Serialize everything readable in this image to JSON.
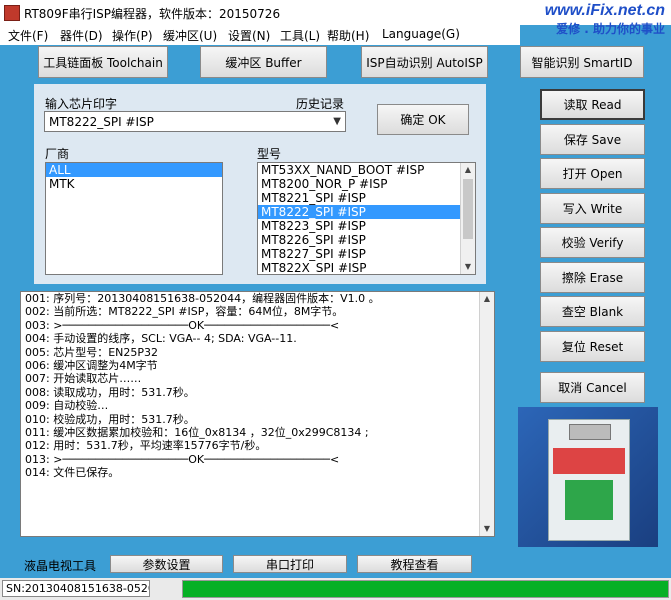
{
  "title": "RT809F串行ISP编程器，软件版本：20150726",
  "watermark": {
    "site": "www.iFix.net.cn",
    "slogan": "爱修 . 助力你的事业"
  },
  "menu": [
    "文件(F)",
    "器件(D)",
    "操作(P)",
    "缓冲区(U)",
    "设置(N)",
    "工具(L)",
    "帮助(H)",
    "Language(G)"
  ],
  "toolbar": {
    "toolchain": "工具链面板 Toolchain",
    "buffer": "缓冲区 Buffer",
    "autoisp": "ISP自动识别 AutoISP",
    "smartid": "智能识别 SmartID"
  },
  "chip_input": {
    "label": "输入芯片印字",
    "history_label": "历史记录",
    "value": "MT8222_SPI #ISP",
    "ok_button": "确定 OK"
  },
  "vendor": {
    "label": "厂商",
    "items": [
      "ALL",
      "MTK"
    ],
    "selected": "ALL"
  },
  "model": {
    "label": "型号",
    "items": [
      "MT53XX_NAND_BOOT #ISP",
      "MT8200_NOR_P #ISP",
      "MT8221_SPI #ISP",
      "MT8222_SPI #ISP",
      "MT8223_SPI #ISP",
      "MT8226_SPI #ISP",
      "MT8227_SPI #ISP",
      "MT822X_SPI #ISP"
    ],
    "selected": "MT8222_SPI #ISP"
  },
  "log_lines": [
    "001: 序列号：20130408151638-052044，编程器固件版本：V1.0 。",
    "002: 当前所选：MT8222_SPI #ISP，容量：64M位，8M字节。",
    "003: >───────────────────OK───────────────────<",
    "004: 手动设置的线序，SCL: VGA-- 4; SDA: VGA--11.",
    "005: 芯片型号：EN25P32",
    "006: 缓冲区调整为4M字节",
    "007: 开始读取芯片……",
    "008: 读取成功，用时：531.7秒。",
    "009: 自动校验…",
    "010: 校验成功，用时：531.7秒。",
    "011: 缓冲区数据累加校验和：16位_0x8134 ，32位_0x299C8134 ;",
    "012: 用时：531.7秒，平均速率15776字节/秒。",
    "013: >───────────────────OK───────────────────<",
    "014: 文件已保存。"
  ],
  "side_buttons": {
    "read": "读取 Read",
    "save": "保存 Save",
    "open": "打开 Open",
    "write": "写入 Write",
    "verify": "校验 Verify",
    "erase": "擦除 Erase",
    "blank": "查空 Blank",
    "reset": "复位 Reset",
    "cancel": "取消 Cancel"
  },
  "bottom": {
    "tv_tools": "液晶电视工具",
    "params": "参数设置",
    "serial_print": "串口打印",
    "tutorial": "教程查看"
  },
  "status": {
    "sn": "SN:20130408151638-0520",
    "progress": 1.0
  },
  "colors": {
    "background": "#3c9ed4",
    "selection": "#3399ff",
    "progress": "#06b025"
  }
}
